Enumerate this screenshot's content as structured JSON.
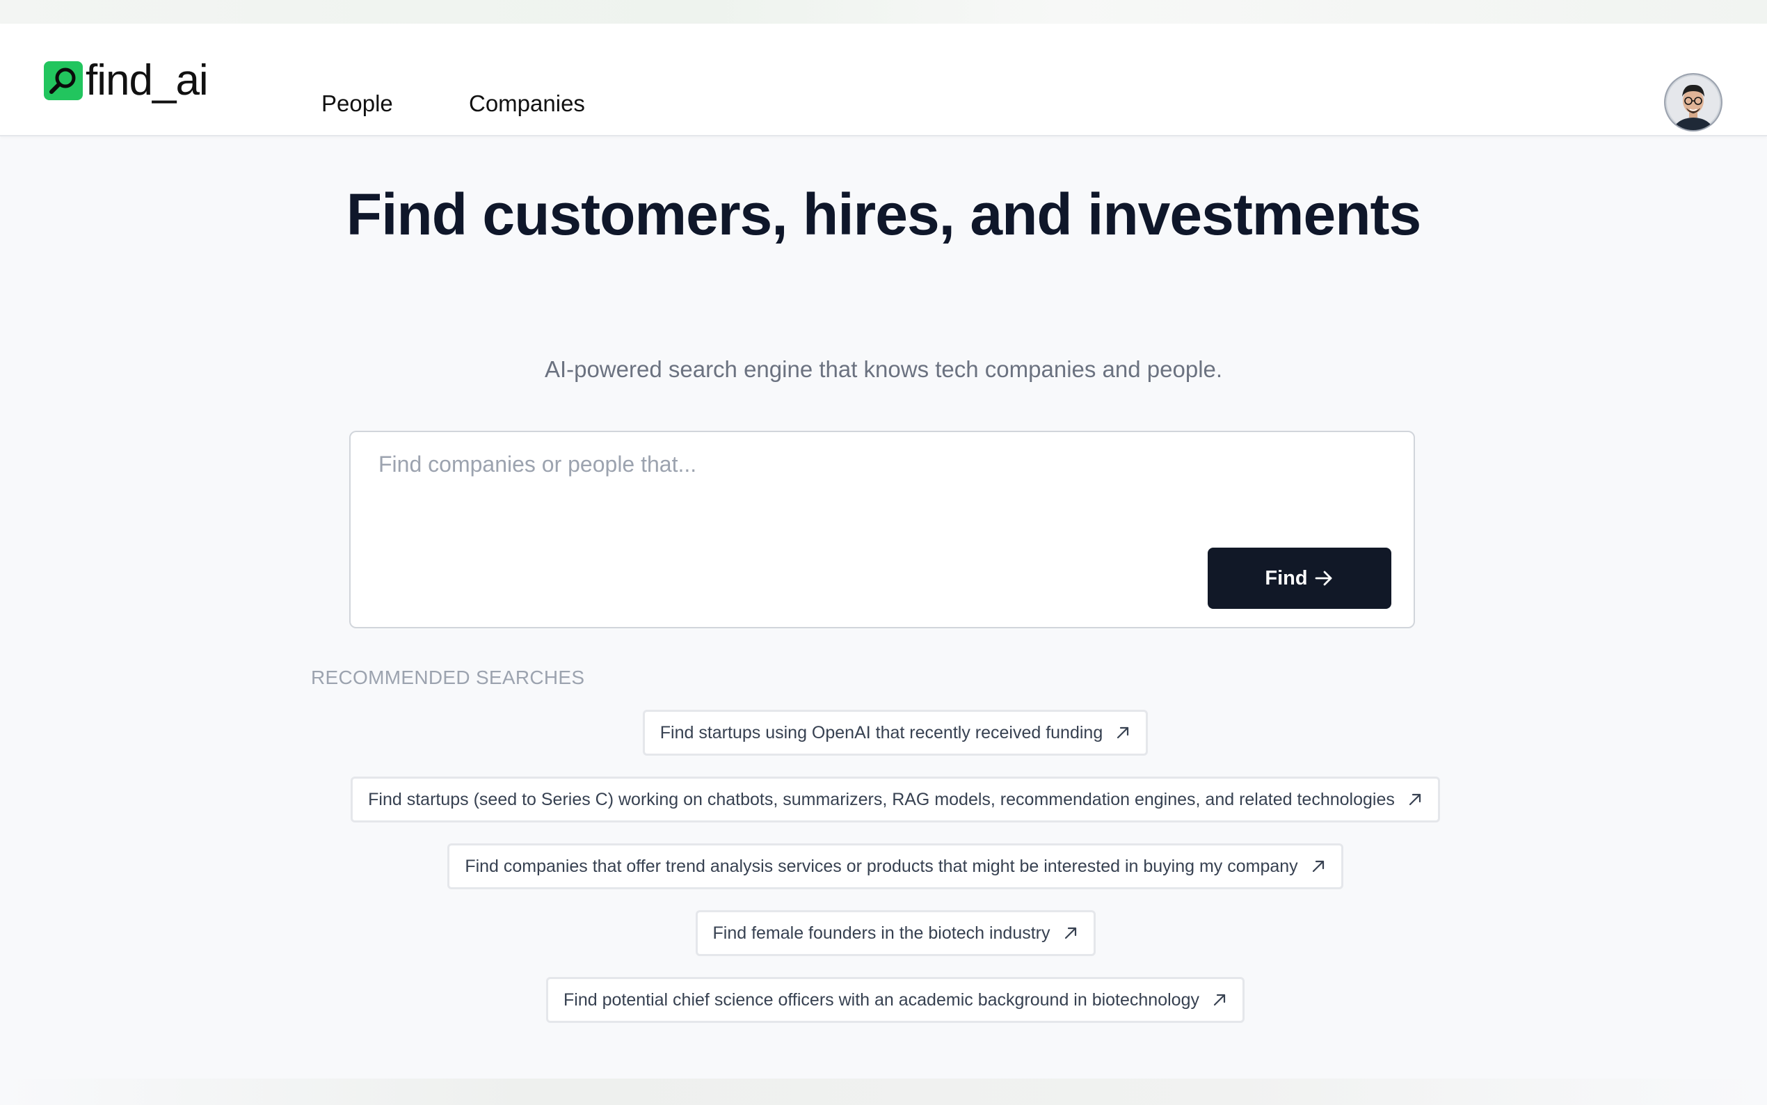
{
  "header": {
    "logo_text": "find_ai",
    "nav": [
      {
        "label": "People"
      },
      {
        "label": "Companies"
      }
    ],
    "avatar_icon": "user-avatar"
  },
  "hero": {
    "title": "Find customers, hires, and investments",
    "subtitle": "AI-powered search engine that knows tech companies and people."
  },
  "search": {
    "placeholder": "Find companies or people that...",
    "value": "",
    "button_label": "Find",
    "button_icon": "arrow-right-icon"
  },
  "recommended": {
    "heading": "RECOMMENDED SEARCHES",
    "items": [
      {
        "label": "Find startups using OpenAI that recently received funding"
      },
      {
        "label": "Find startups (seed to Series C) working on chatbots, summarizers, RAG models, recommendation engines, and related technologies"
      },
      {
        "label": "Find companies that offer trend analysis services or products that might be interested in buying my company"
      },
      {
        "label": "Find female founders in the biotech industry"
      },
      {
        "label": "Find potential chief science officers with an academic background in biotechnology"
      }
    ]
  },
  "colors": {
    "brand_green": "#22c55e",
    "button_dark": "#111827",
    "background": "#f8f9fb"
  }
}
